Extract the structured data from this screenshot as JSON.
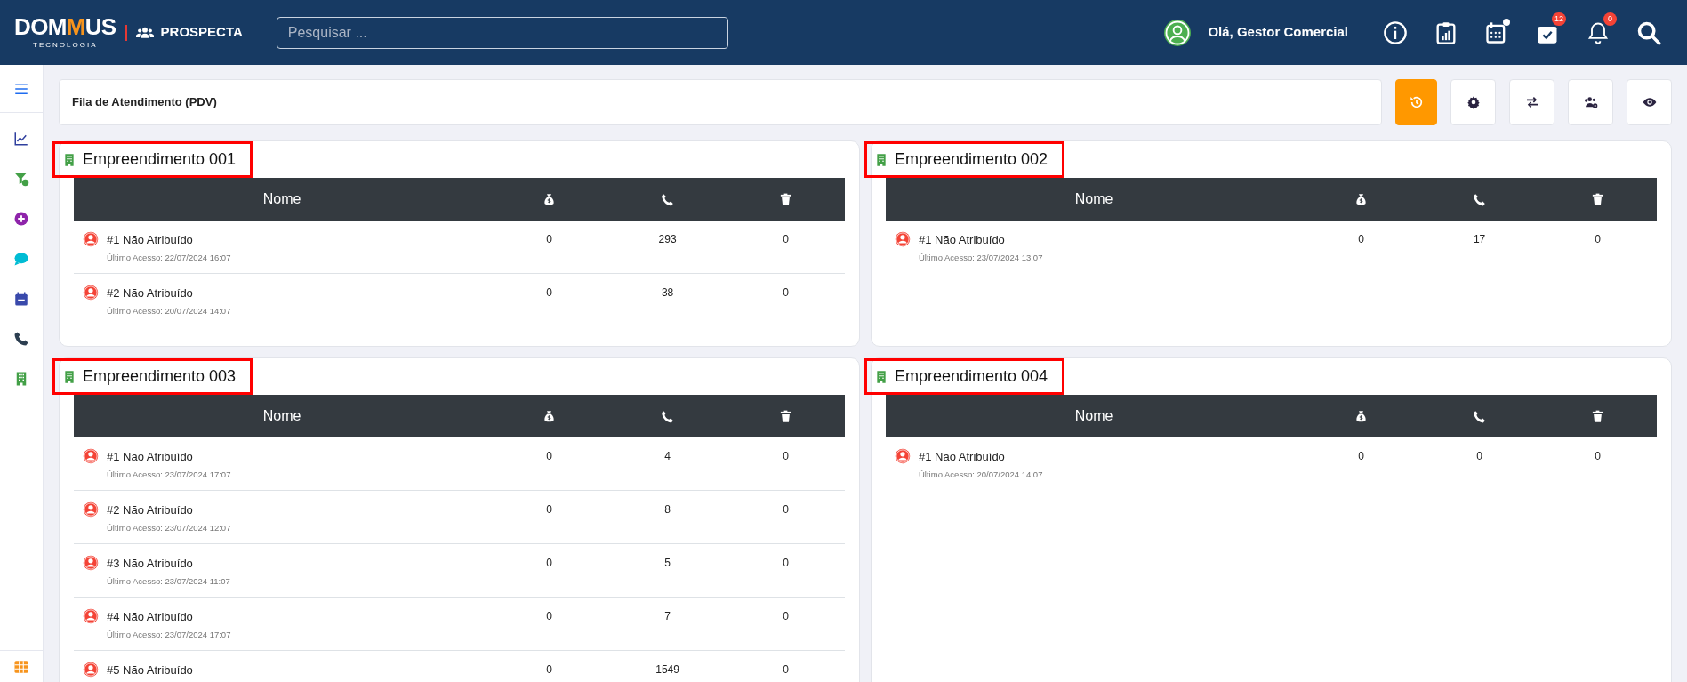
{
  "header": {
    "logo": {
      "parts": [
        "DOM",
        "M",
        "US"
      ],
      "tagline": "TECNOLOGIA"
    },
    "module": "PROSPECTA",
    "search": {
      "placeholder": "Pesquisar ..."
    },
    "greeting": "Olá, Gestor Comercial",
    "icons": [
      {
        "kind": "info"
      },
      {
        "kind": "report"
      },
      {
        "kind": "calendar",
        "dot": true
      },
      {
        "kind": "tasks",
        "badge": "12"
      },
      {
        "kind": "bell",
        "badge": "0"
      },
      {
        "kind": "search"
      }
    ]
  },
  "sidebar": {
    "items": [
      {
        "kind": "chart",
        "color": "#2f3f9e"
      },
      {
        "kind": "funnel",
        "color": "#43a047"
      },
      {
        "kind": "plus",
        "color": "#8e24aa"
      },
      {
        "kind": "chat",
        "color": "#00bcd4"
      },
      {
        "kind": "calendar",
        "color": "#3949ab"
      },
      {
        "kind": "phone",
        "color": "#2c3e50"
      },
      {
        "kind": "building",
        "color": "#43a047"
      }
    ]
  },
  "toolbar": {
    "title": "Fila de Atendimento (PDV)",
    "buttons": [
      {
        "kind": "history",
        "active": true
      },
      {
        "kind": "gear",
        "active": false
      },
      {
        "kind": "swap",
        "active": false
      },
      {
        "kind": "users",
        "active": false
      },
      {
        "kind": "eye",
        "active": false
      }
    ]
  },
  "cards": [
    {
      "title": "Empreendimento 001",
      "highlighted": true,
      "columns": [
        "Nome"
      ],
      "rows": [
        {
          "name": "#1 Não Atribuído",
          "last_access": "Último Acesso: 22/07/2024 16:07",
          "values": [
            "0",
            "293",
            "0"
          ]
        },
        {
          "name": "#2 Não Atribuído",
          "last_access": "Último Acesso: 20/07/2024 14:07",
          "values": [
            "0",
            "38",
            "0"
          ]
        }
      ]
    },
    {
      "title": "Empreendimento 002",
      "highlighted": true,
      "columns": [
        "Nome"
      ],
      "rows": [
        {
          "name": "#1 Não Atribuído",
          "last_access": "Último Acesso: 23/07/2024 13:07",
          "values": [
            "0",
            "17",
            "0"
          ]
        }
      ]
    },
    {
      "title": "Empreendimento 003",
      "highlighted": true,
      "columns": [
        "Nome"
      ],
      "rows": [
        {
          "name": "#1 Não Atribuído",
          "last_access": "Último Acesso: 23/07/2024 17:07",
          "values": [
            "0",
            "4",
            "0"
          ]
        },
        {
          "name": "#2 Não Atribuído",
          "last_access": "Último Acesso: 23/07/2024 12:07",
          "values": [
            "0",
            "8",
            "0"
          ]
        },
        {
          "name": "#3 Não Atribuído",
          "last_access": "Último Acesso: 23/07/2024 11:07",
          "values": [
            "0",
            "5",
            "0"
          ]
        },
        {
          "name": "#4 Não Atribuído",
          "last_access": "Último Acesso: 23/07/2024 17:07",
          "values": [
            "0",
            "7",
            "0"
          ]
        },
        {
          "name": "#5 Não Atribuído",
          "values": [
            "0",
            "1549",
            "0"
          ]
        }
      ]
    },
    {
      "title": "Empreendimento 004",
      "highlighted": true,
      "columns": [
        "Nome"
      ],
      "rows": [
        {
          "name": "#1 Não Atribuído",
          "last_access": "Último Acesso: 20/07/2024 14:07",
          "values": [
            "0",
            "0",
            "0"
          ]
        }
      ]
    }
  ]
}
